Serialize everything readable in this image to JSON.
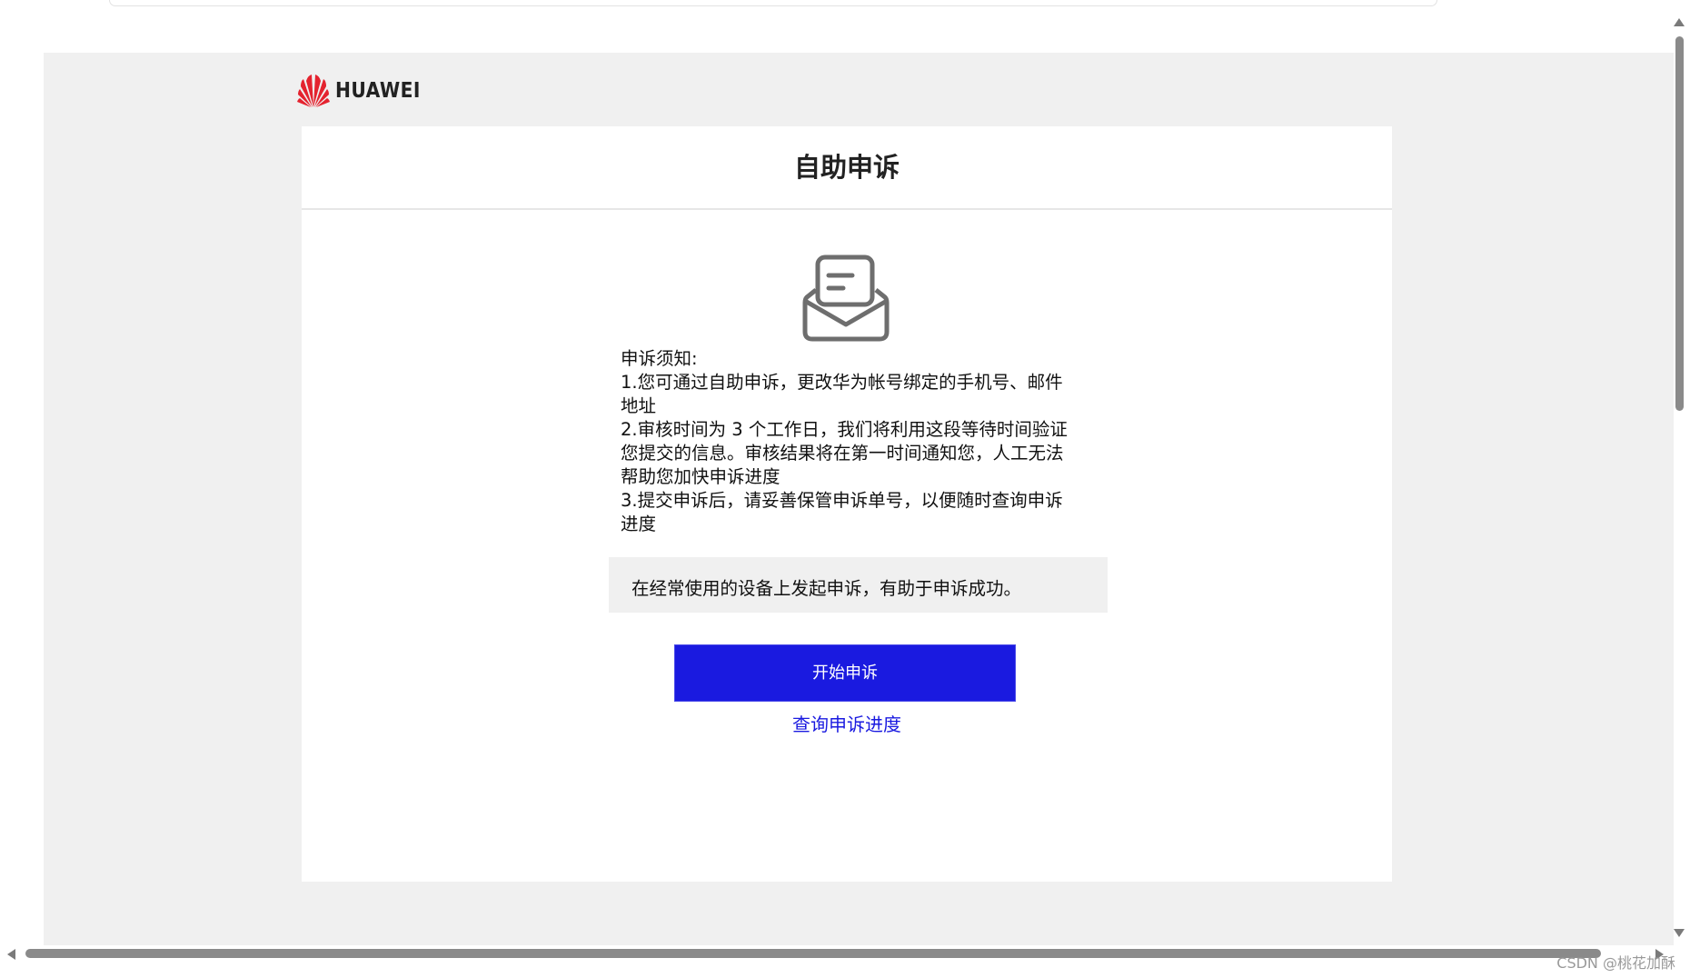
{
  "brand": {
    "name": "HUAWEI",
    "logo_color": "#e4232f"
  },
  "card": {
    "title": "自助申诉",
    "notice_lines": [
      "申诉须知:",
      "1.您可通过自助申诉，更改华为帐号绑定的手机号、邮件",
      "地址",
      "2.审核时间为 3 个工作日，我们将利用这段等待时间验证",
      "您提交的信息。审核结果将在第一时间通知您，人工无法",
      "帮助您加快申诉进度",
      "3.提交申诉后，请妥善保管申诉单号，以便随时查询申诉",
      "进度"
    ],
    "tip": "在经常使用的设备上发起申诉，有助于申诉成功。",
    "start_button_label": "开始申诉",
    "query_link_label": "查询申诉进度"
  },
  "icons": {
    "mail": "envelope-document-icon"
  },
  "colors": {
    "primary": "#1a1ae0",
    "page_background": "#f0f0f0",
    "card_background": "#ffffff"
  },
  "watermark": "CSDN @桃花加酥"
}
